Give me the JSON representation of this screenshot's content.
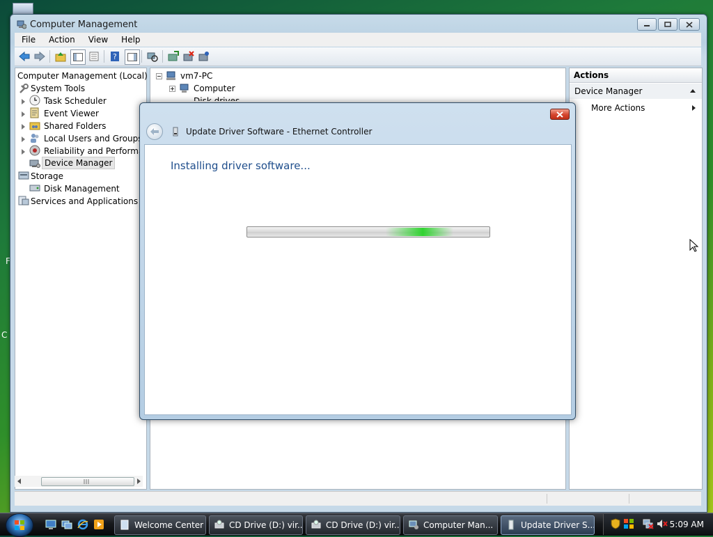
{
  "desktop": {
    "left_fragment_1": "F",
    "left_fragment_2": "C"
  },
  "window": {
    "title": "Computer Management",
    "menu": [
      "File",
      "Action",
      "View",
      "Help"
    ]
  },
  "tree": {
    "root": "Computer Management (Local)",
    "system_tools": "System Tools",
    "task_scheduler": "Task Scheduler",
    "event_viewer": "Event Viewer",
    "shared_folders": "Shared Folders",
    "local_users": "Local Users and Groups",
    "reliability": "Reliability and Performance",
    "device_manager": "Device Manager",
    "storage": "Storage",
    "disk_management": "Disk Management",
    "services": "Services and Applications"
  },
  "device_tree": {
    "root": "vm7-PC",
    "computer": "Computer",
    "disk_drives": "Disk drives"
  },
  "actions": {
    "header": "Actions",
    "section": "Device Manager",
    "more": "More Actions"
  },
  "dialog": {
    "title": "Update Driver Software - Ethernet Controller",
    "status": "Installing driver software...",
    "close": "x",
    "progress": 0.85
  },
  "taskbar": {
    "tasks": [
      "Welcome Center",
      "CD Drive (D:) vir...",
      "CD Drive (D:) vir...",
      "Computer Man...",
      "Update Driver S..."
    ],
    "clock": "5:09 AM"
  },
  "colors": {
    "accent": "#1f4e8c",
    "progress_green": "#28d228",
    "close_red": "#c23017"
  }
}
